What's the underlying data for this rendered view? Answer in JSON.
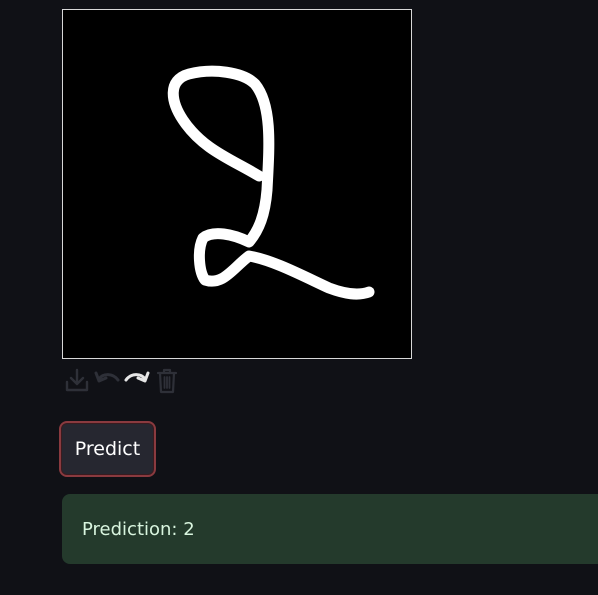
{
  "canvas": {
    "background": "#000000",
    "stroke_color": "#ffffff"
  },
  "toolbar": {
    "icons": [
      "download-icon",
      "undo-icon",
      "redo-icon",
      "trash-icon"
    ]
  },
  "predict_button": {
    "label": "Predict",
    "border_color": "#8a3a3f"
  },
  "result": {
    "text": "Prediction: 2",
    "background": "#243a2c"
  }
}
